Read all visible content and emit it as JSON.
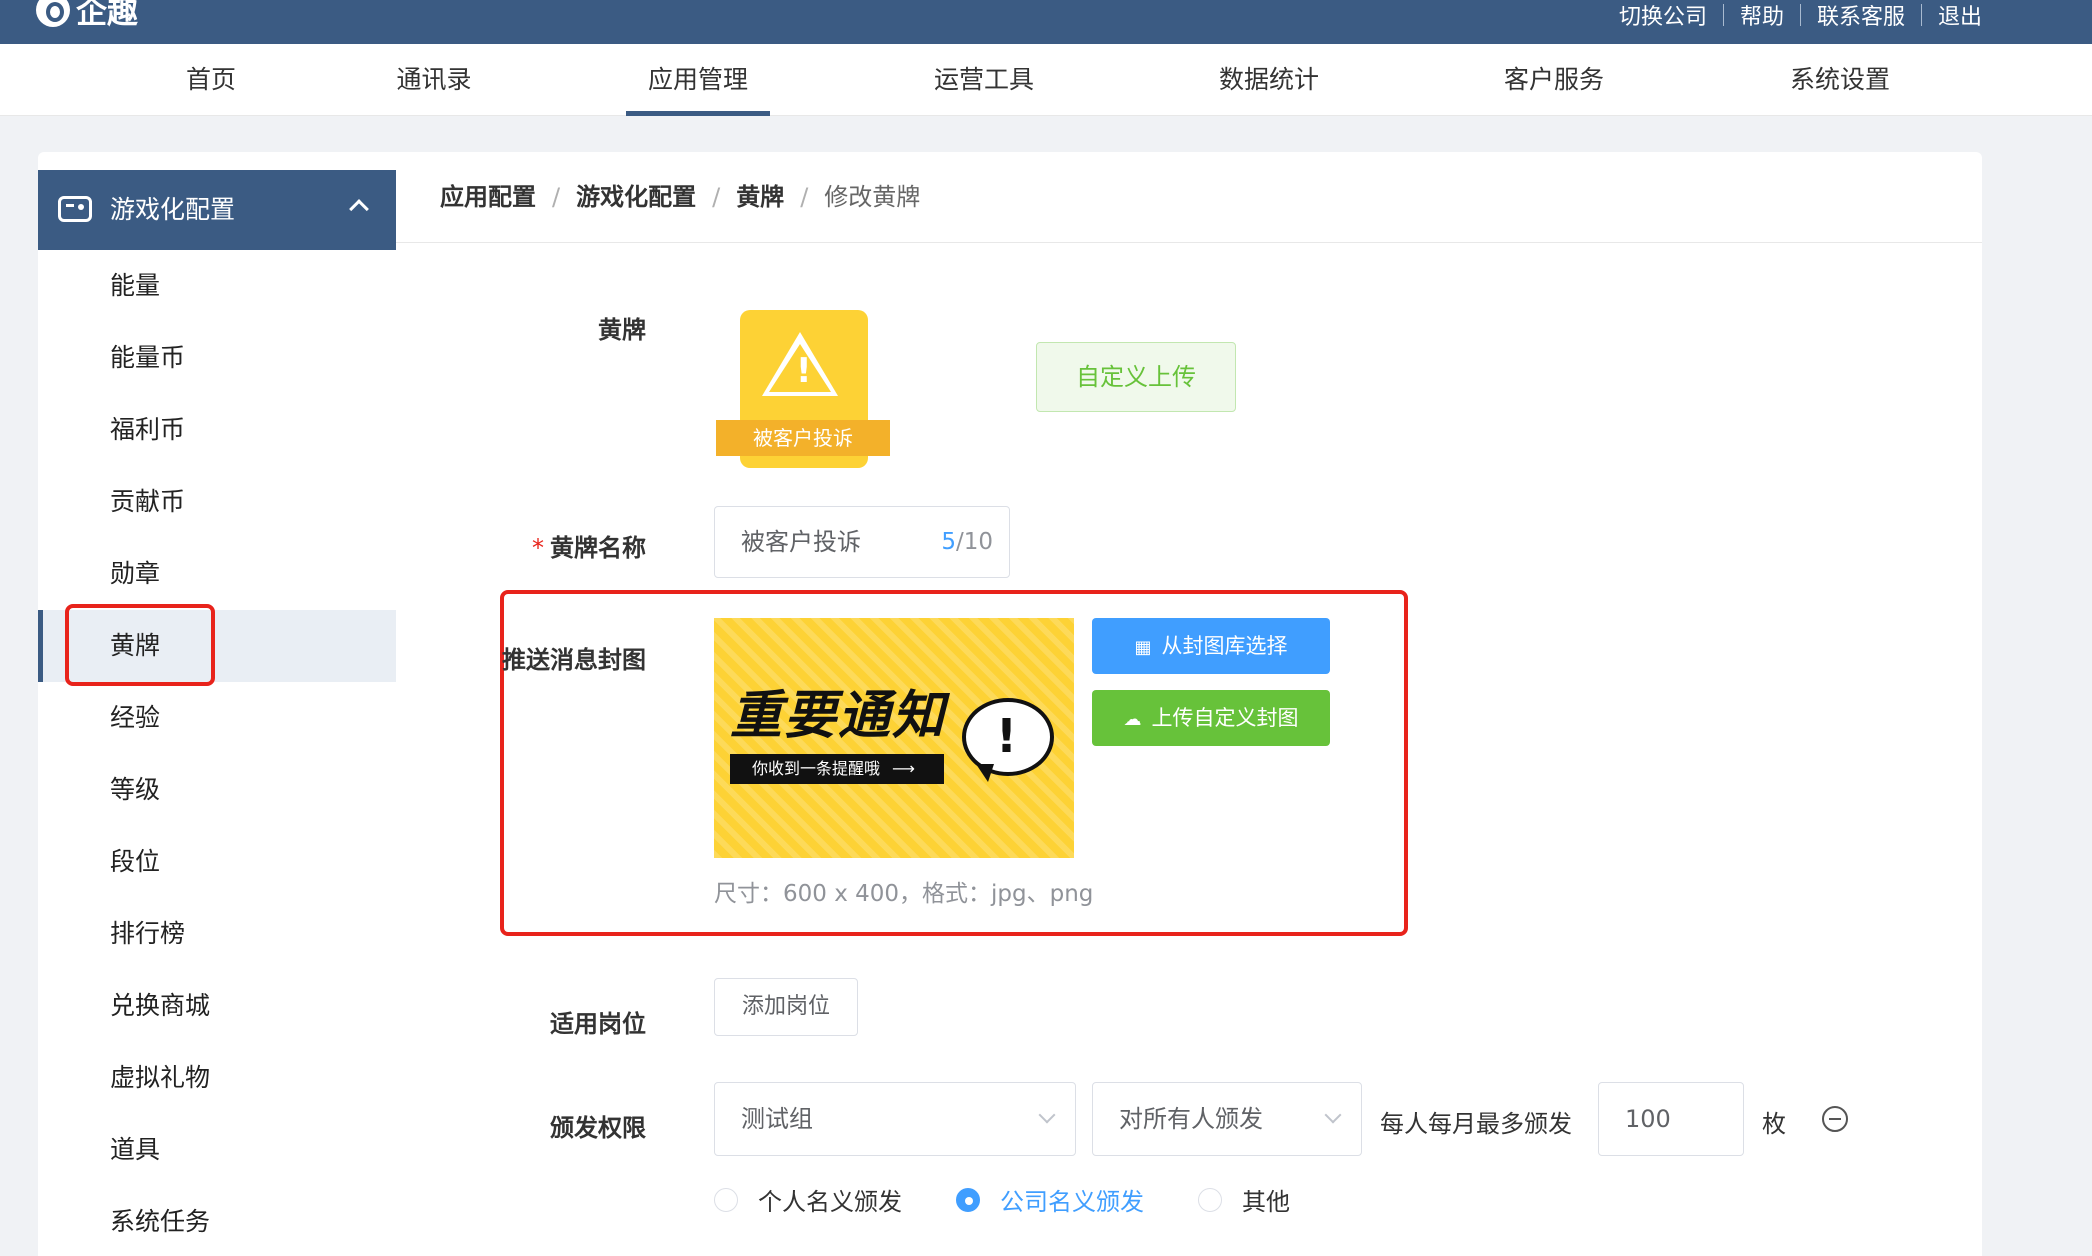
{
  "app": {
    "logo_text": "企趣"
  },
  "top_links": [
    "切换公司",
    "帮助",
    "联系客服",
    "退出"
  ],
  "nav": [
    "首页",
    "通讯录",
    "应用管理",
    "运营工具",
    "数据统计",
    "客户服务",
    "系统设置"
  ],
  "nav_active": "应用管理",
  "sidebar": {
    "header": "游戏化配置",
    "items": [
      "能量",
      "能量币",
      "福利币",
      "贡献币",
      "勋章",
      "黄牌",
      "经验",
      "等级",
      "段位",
      "排行榜",
      "兑换商城",
      "虚拟礼物",
      "道具",
      "系统任务"
    ],
    "active": "黄牌"
  },
  "breadcrumb": [
    "应用配置",
    "游戏化配置",
    "黄牌",
    "修改黄牌"
  ],
  "form": {
    "badge_label": "黄牌",
    "badge_caption": "被客户投诉",
    "custom_upload_button": "自定义上传",
    "name_label": "黄牌名称",
    "name_required_mark": "*",
    "name_value": "被客户投诉",
    "name_count": "5",
    "name_max": "/10",
    "cover_label": "推送消息封图",
    "cover_image": {
      "title": "重要通知",
      "subtitle": "你收到一条提醒哦",
      "arrow": "⟶",
      "exclaim": "!"
    },
    "choose_cover_button": "从封图库选择",
    "upload_cover_button": "上传自定义封图",
    "cover_hint": "尺寸：600 x 400，格式：jpg、png",
    "position_label": "适用岗位",
    "add_position_button": "添加岗位",
    "permission_label": "颁发权限",
    "group_select": "测试组",
    "scope_select": "对所有人颁发",
    "monthly_limit_label": "每人每月最多颁发",
    "monthly_limit_value": "100",
    "unit": "枚",
    "radios": [
      "个人名义颁发",
      "公司名义颁发",
      "其他"
    ],
    "radio_checked": "公司名义颁发"
  },
  "colors": {
    "brand": "#3b5b83",
    "primary": "#409eff",
    "success": "#67c23a",
    "highlight": "#e8231b",
    "badge": "#fdd235"
  },
  "icons": [
    "logo-icon",
    "gamepad-icon",
    "chevron-up-icon",
    "warning-icon",
    "grid-icon",
    "cloud-upload-icon",
    "chevron-down-icon",
    "minus-circle-icon"
  ]
}
